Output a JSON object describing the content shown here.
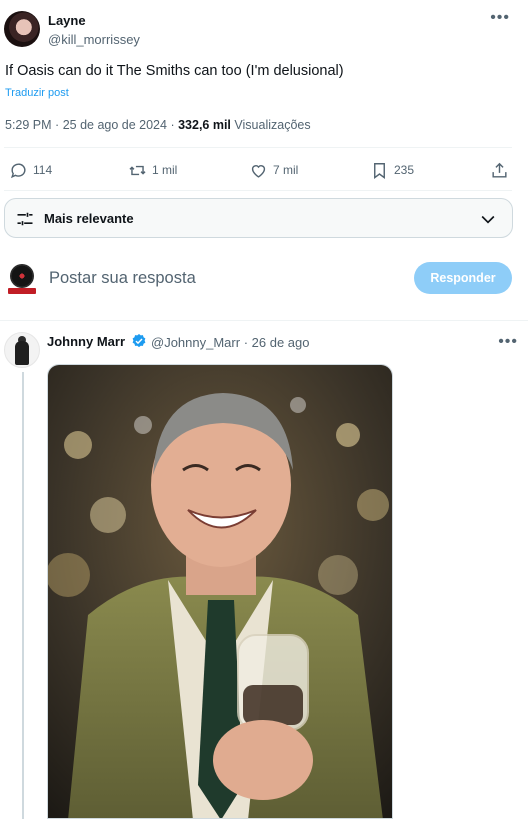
{
  "tweet": {
    "author_name": "Layne",
    "author_handle": "@kill_morrissey",
    "text": "If Oasis can do it The Smiths can too (I'm delusional)",
    "translate_label": "Traduzir post",
    "time": "5:29 PM",
    "date": "25 de ago de 2024",
    "views_count": "332,6 mil",
    "views_label": "Visualizações"
  },
  "actions": {
    "replies": "114",
    "reposts": "1 mil",
    "likes": "7 mil",
    "bookmarks": "235"
  },
  "sort": {
    "label": "Mais relevante"
  },
  "reply_composer": {
    "placeholder": "Postar sua resposta",
    "button_label": "Responder"
  },
  "reply": {
    "author_name": "Johnny Marr",
    "author_handle": "@Johnny_Marr",
    "date": "26 de ago"
  },
  "colors": {
    "accent": "#1d9bf0",
    "button_disabled": "#8ecdf8",
    "muted_text": "#536471"
  }
}
